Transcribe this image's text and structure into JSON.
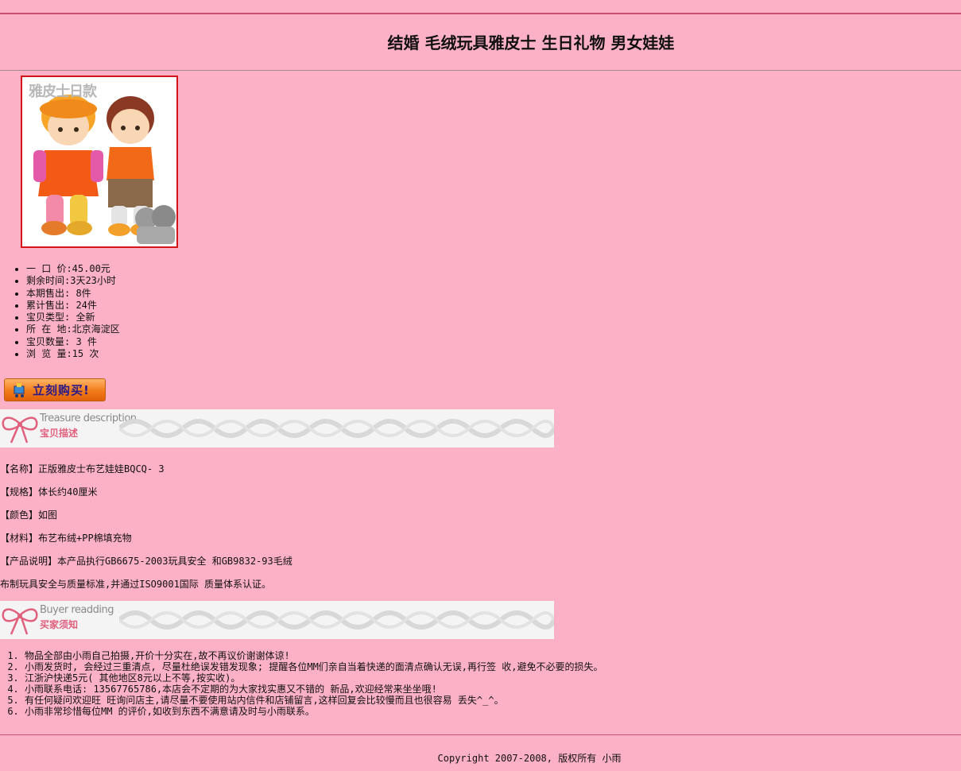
{
  "page": {
    "title": "结婚 毛绒玩具雅皮士 生日礼物 男女娃娃"
  },
  "product_image": {
    "caption": "雅皮士日款"
  },
  "specs": [
    "一 口 价:45.00元",
    "剩余时间:3天23小时",
    "本期售出: 8件",
    "累计售出: 24件",
    "宝贝类型: 全新",
    "所 在 地:北京海淀区",
    "宝贝数量: 3 件",
    "浏 览 量:15 次"
  ],
  "buy_button": {
    "label": "立刻购买!"
  },
  "description_banner": {
    "en": "Treasure description",
    "cn": "宝贝描述"
  },
  "description": [
    "【名称】正版雅皮士布艺娃娃BQCQ- 3",
    "【规格】体长约40厘米",
    "【颜色】如图",
    "【材料】布艺布绒+PP棉填充物",
    "【产品说明】本产品执行GB6675-2003玩具安全 和GB9832-93毛绒",
    "布制玩具安全与质量标准,并通过ISO9001国际 质量体系认证。"
  ],
  "notes_banner": {
    "en": "Buyer readding",
    "cn": "买家须知"
  },
  "notes": [
    "物品全部由小雨自己拍摄,开价十分实在,故不再议价谢谢体谅!",
    "小雨发货时, 会经过三重清点, 尽量杜绝误发错发现象; 提醒各位MM们亲自当着快递的面清点确认无误,再行签 收,避免不必要的损失。",
    "江浙沪快递5元( 其他地区8元以上不等,按实收)。",
    "小雨联系电话: 13567765786,本店会不定期的为大家找实惠又不错的 新品,欢迎经常来坐坐哦!",
    "有任何疑问欢迎旺 旺询问店主,请尽量不要使用站内信件和店铺留言,这样回复会比较慢而且也很容易 丢失^_^。",
    "小雨非常珍惜每位MM 的评价,如收到东西不满意请及时与小雨联系。"
  ],
  "footer": {
    "copyright": "Copyright 2007-2008, 版权所有 小雨"
  },
  "colors": {
    "background": "#fcb1c7",
    "rule": "#c8506e",
    "photo_border": "#d41418",
    "button": "#f17b18"
  }
}
